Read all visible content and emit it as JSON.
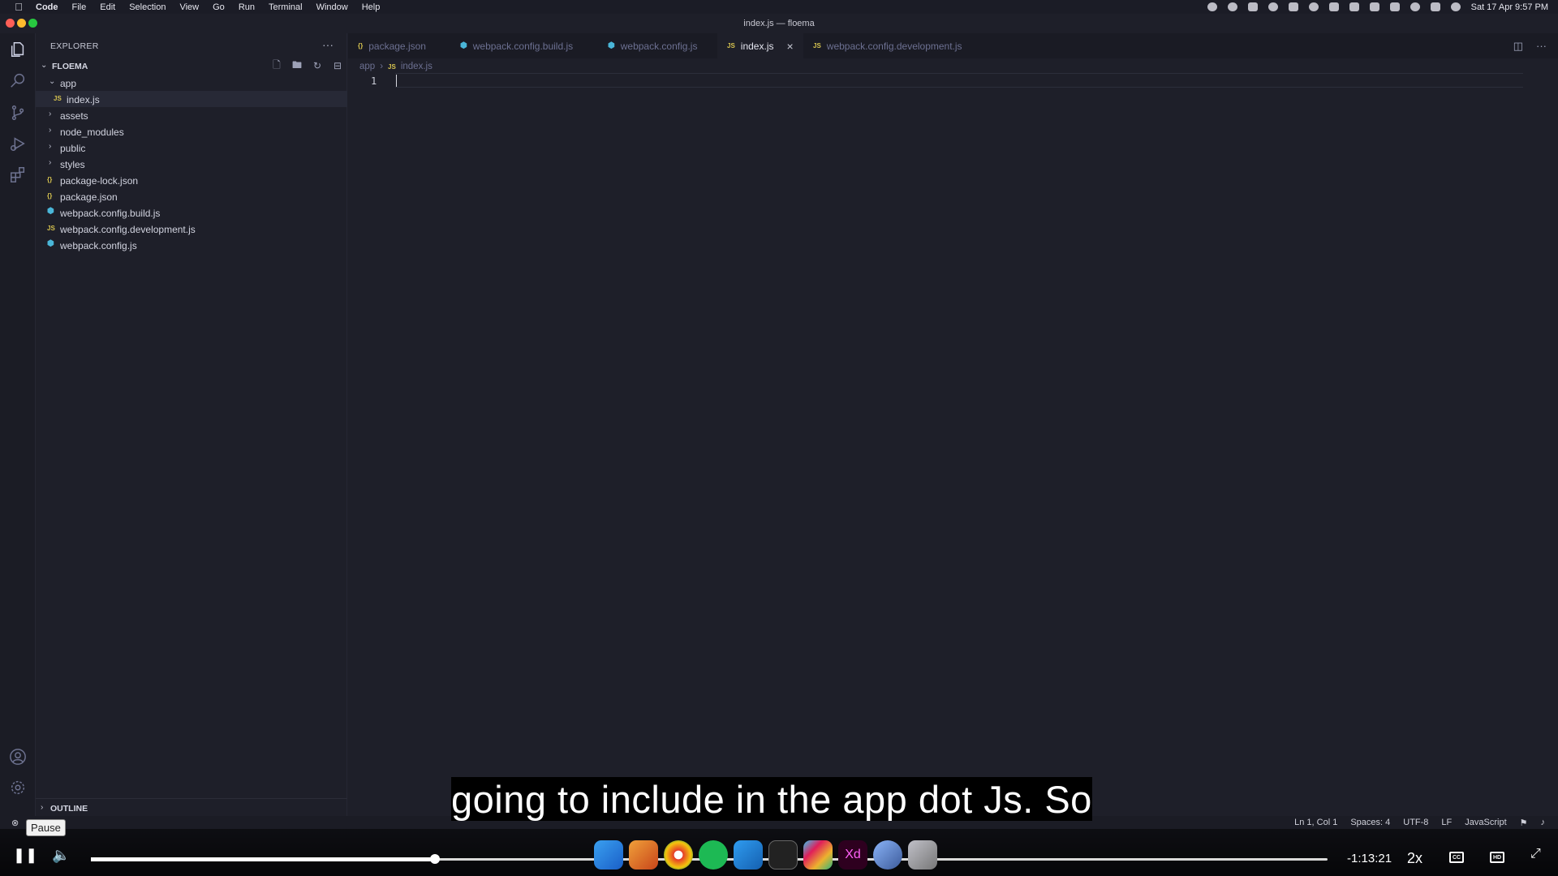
{
  "menubar": {
    "items": [
      "Code",
      "File",
      "Edit",
      "Selection",
      "View",
      "Go",
      "Run",
      "Terminal",
      "Window",
      "Help"
    ],
    "clock": "Sat 17 Apr  9:57 PM"
  },
  "window": {
    "title": "index.js — floema"
  },
  "sidebar": {
    "header": "EXPLORER",
    "more": "···",
    "root": "FLOEMA",
    "tree": [
      {
        "name": "app",
        "type": "folder",
        "expanded": true,
        "level": 0
      },
      {
        "name": "index.js",
        "type": "js",
        "level": 1
      },
      {
        "name": "assets",
        "type": "folder",
        "level": 0
      },
      {
        "name": "node_modules",
        "type": "folder",
        "level": 0
      },
      {
        "name": "public",
        "type": "folder",
        "level": 0
      },
      {
        "name": "styles",
        "type": "folder",
        "level": 0
      },
      {
        "name": "package-lock.json",
        "type": "json",
        "level": 0
      },
      {
        "name": "package.json",
        "type": "json",
        "level": 0
      },
      {
        "name": "webpack.config.build.js",
        "type": "webpack",
        "level": 0
      },
      {
        "name": "webpack.config.development.js",
        "type": "js",
        "level": 0
      },
      {
        "name": "webpack.config.js",
        "type": "webpack",
        "level": 0
      }
    ],
    "outline": "OUTLINE"
  },
  "tabs": [
    {
      "label": "package.json",
      "icon": "{ }",
      "active": false
    },
    {
      "label": "webpack.config.build.js",
      "icon": "webpack",
      "active": false
    },
    {
      "label": "webpack.config.js",
      "icon": "webpack",
      "active": false
    },
    {
      "label": "index.js",
      "icon": "JS",
      "active": true
    },
    {
      "label": "webpack.config.development.js",
      "icon": "JS",
      "active": false
    }
  ],
  "breadcrumb": {
    "folder": "app",
    "file": "index.js",
    "file_icon": "JS"
  },
  "editor": {
    "line_number": "1"
  },
  "statusbar": {
    "cursor": "Ln 1, Col 1",
    "spaces": "Spaces: 4",
    "encoding": "UTF-8",
    "eol": "LF",
    "language": "JavaScript"
  },
  "tooltip": "Pause",
  "caption": "going to include in the app dot Js. So",
  "player": {
    "time_remaining": "-1:13:21",
    "speed": "2x",
    "progress": 0.278
  },
  "colors": {
    "accent": "#4ab6d8",
    "js": "#d7c44f",
    "close_red": "#ff5f57",
    "minimize_yellow": "#febc2e",
    "maximize_green": "#28c840"
  }
}
